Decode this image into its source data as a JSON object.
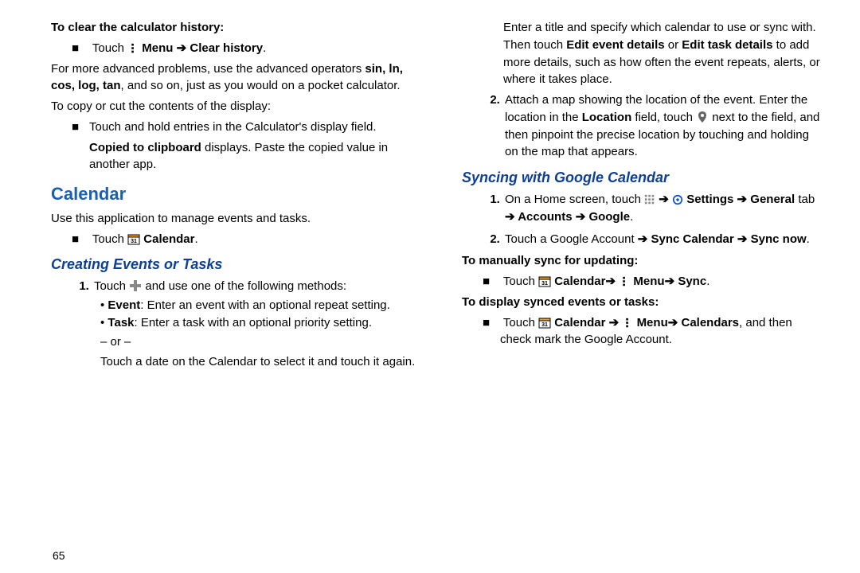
{
  "pageNumber": "65",
  "left": {
    "clearHeading": "To clear the calculator history:",
    "clearItemPrefix": "Touch ",
    "menuLabel": "Menu",
    "clearHistoryLabel": "Clear history",
    "advPara1a": "For more advanced problems, use the advanced operators ",
    "advPara1b": ", and so on, just as you would on a pocket calculator.",
    "advOps": "sin, ln, cos, log, tan",
    "copyCutHeading": "To copy or cut the contents of the display:",
    "copyItem1": "Touch and hold entries in the Calculator's display field.",
    "copyItem2a": "Copied to clipboard",
    "copyItem2b": " displays. Paste the copied value in another app.",
    "calendarHeading": "Calendar",
    "calendarIntro": "Use this application to manage events and tasks.",
    "touchCalendarPrefix": "Touch ",
    "calendarLabel": "Calendar",
    "createHeading": "Creating Events or Tasks",
    "createStep1Prefix": "Touch ",
    "createStep1Suffix": " and use one of the following methods:",
    "eventLabel": "Event",
    "eventDesc": ": Enter an event with an optional repeat setting.",
    "taskLabel": "Task",
    "taskDesc": ": Enter a task with an optional priority setting.",
    "or": "– or –",
    "touchDate": "Touch a date on the Calendar to select it and touch it again."
  },
  "right": {
    "enterTitle1": "Enter a title and specify which calendar to use or sync with. Then touch ",
    "editEvent": "Edit event details",
    "orWord": " or ",
    "editTask": "Edit task details",
    "enterTitle2": " to add more details, such as how often the event repeats, alerts, or where it takes place.",
    "step2a": "Attach a map showing the location of the event. Enter the location in the ",
    "locationLabel": "Location",
    "step2b": " field, touch ",
    "step2c": " next to the field, and then pinpoint the precise location by touching and holding on the map that appears.",
    "syncHeading": "Syncing with Google Calendar",
    "syncStep1a": "On a Home screen, touch ",
    "settingsLabel": "Settings",
    "generalTab": "General",
    "tabWord": " tab ",
    "accountsLabel": "Accounts",
    "googleLabel": "Google",
    "syncStep2a": "Touch a Google Account ",
    "syncCalendarLabel": "Sync Calendar",
    "syncNowLabel": "Sync now",
    "manualSyncHeading": "To manually sync for updating:",
    "manualTouchPrefix": "Touch ",
    "syncLabel": "Sync",
    "displaySyncedHeading": "To display synced events or tasks:",
    "calendarsLabel": "Calendars",
    "displaySuffix": ", and then check mark the Google Account."
  }
}
